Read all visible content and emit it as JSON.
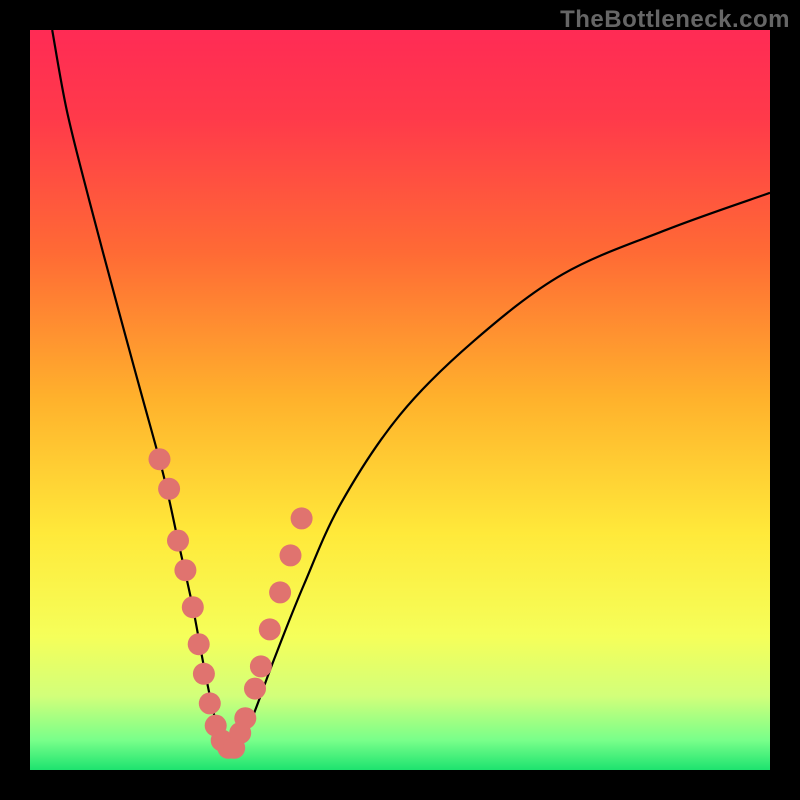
{
  "watermark": "TheBottleneck.com",
  "chart_data": {
    "type": "line",
    "title": "",
    "xlabel": "",
    "ylabel": "",
    "xlim": [
      0,
      100
    ],
    "ylim": [
      0,
      100
    ],
    "series": [
      {
        "name": "bottleneck-curve",
        "x": [
          3,
          5,
          8,
          12,
          15,
          18,
          20,
          22,
          23.5,
          25,
          26.5,
          28,
          30,
          33,
          37,
          42,
          50,
          60,
          72,
          86,
          100
        ],
        "values": [
          100,
          89,
          77,
          62,
          51,
          40,
          31,
          22,
          14,
          7,
          3,
          3,
          7,
          15,
          25,
          36,
          48,
          58,
          67,
          73,
          78
        ]
      }
    ],
    "markers": {
      "name": "sample-points",
      "color": "#e0736f",
      "x": [
        17.5,
        18.8,
        20.0,
        21.0,
        22.0,
        22.8,
        23.5,
        24.3,
        25.1,
        25.9,
        26.8,
        27.6,
        28.4,
        29.1,
        30.4,
        31.2,
        32.4,
        33.8,
        35.2,
        36.7
      ],
      "values": [
        42,
        38,
        31,
        27,
        22,
        17,
        13,
        9,
        6,
        4,
        3,
        3,
        5,
        7,
        11,
        14,
        19,
        24,
        29,
        34
      ]
    },
    "gradient_stops": [
      {
        "offset": 0.0,
        "color": "#ff2b55"
      },
      {
        "offset": 0.12,
        "color": "#ff3a4a"
      },
      {
        "offset": 0.3,
        "color": "#ff6a35"
      },
      {
        "offset": 0.5,
        "color": "#ffb22c"
      },
      {
        "offset": 0.68,
        "color": "#ffe93a"
      },
      {
        "offset": 0.82,
        "color": "#f5ff5a"
      },
      {
        "offset": 0.9,
        "color": "#d2ff7a"
      },
      {
        "offset": 0.96,
        "color": "#78ff8a"
      },
      {
        "offset": 1.0,
        "color": "#1de36f"
      }
    ],
    "frame": {
      "outer_margin": 30,
      "inner_size": 740,
      "border_color": "#000000"
    }
  }
}
